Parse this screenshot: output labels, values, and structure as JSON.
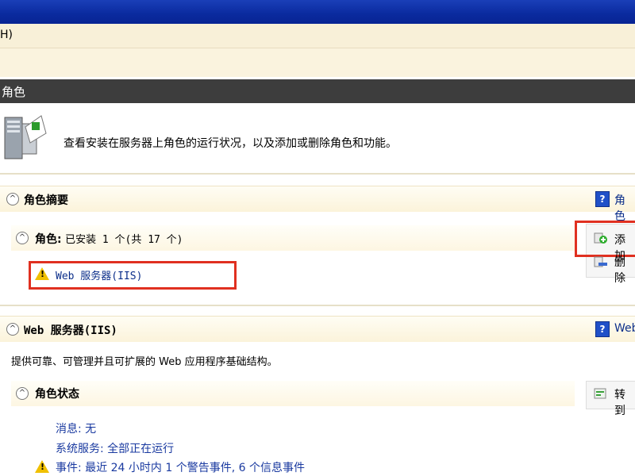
{
  "window": {
    "menu_text": "H)"
  },
  "section": {
    "title": "角色"
  },
  "intro": {
    "text": "查看安装在服务器上角色的运行状况，以及添加或删除角色和功能。"
  },
  "role_summary": {
    "header": "角色摘要",
    "help_link": "角色",
    "roles_line_prefix": "角色:",
    "roles_line_value": "已安装 1 个(共 17 个)",
    "installed_roles": [
      "Web 服务器(IIS)"
    ],
    "actions": {
      "add": "添加",
      "remove": "删除"
    }
  },
  "web_server": {
    "header": "Web 服务器(IIS)",
    "help_link": "Web",
    "description": "提供可靠、可管理并且可扩展的 Web 应用程序基础结构。",
    "status_header": "角色状态",
    "goto_link": "转到",
    "status_items": {
      "messages": "消息: 无",
      "services": "系统服务: 全部正在运行",
      "events": "事件: 最近 24 小时内 1 个警告事件, 6 个信息事件"
    }
  },
  "colors": {
    "highlight_box": "#e03020",
    "header_bg": "#3d3d3d",
    "title_bar": "#0a2a9e"
  }
}
